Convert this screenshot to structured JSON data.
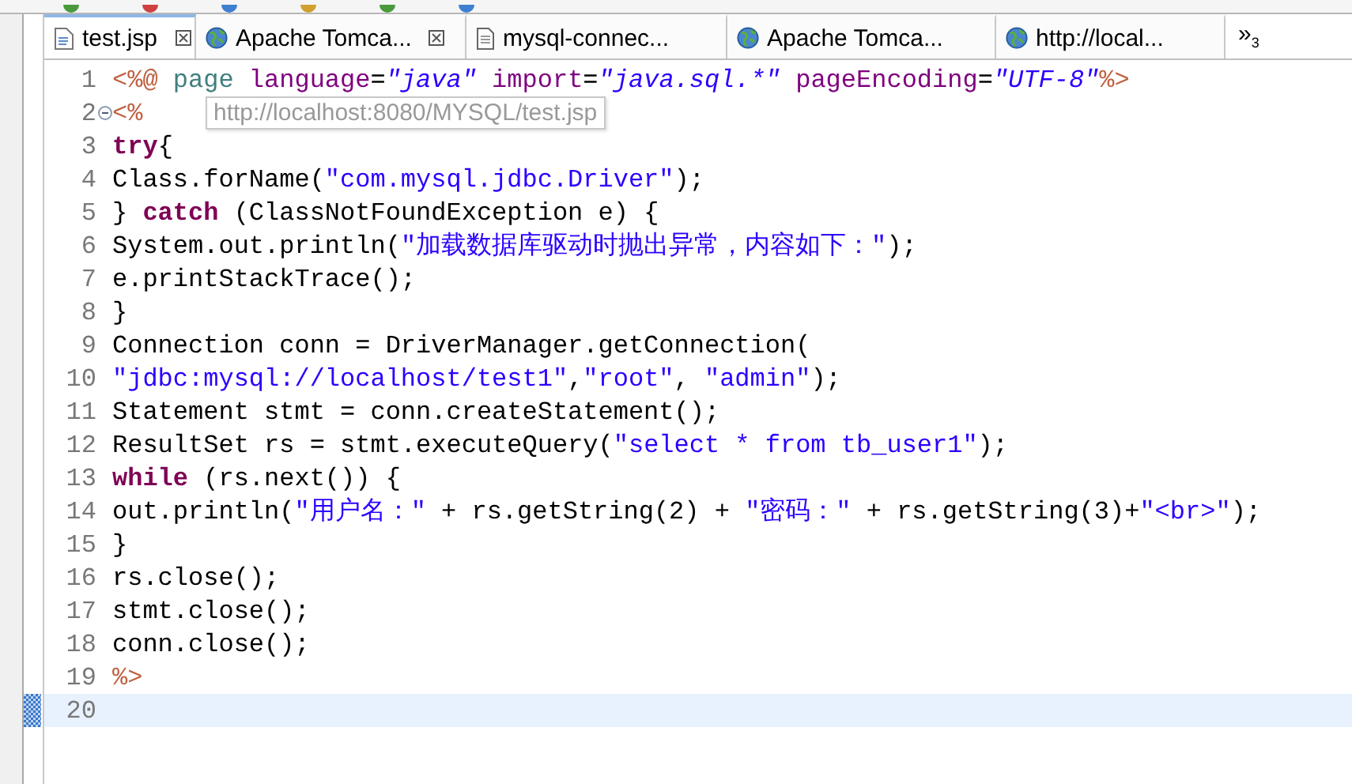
{
  "tabs": [
    {
      "label": "test.jsp",
      "kind": "jsp",
      "closable": true,
      "selected": true
    },
    {
      "label": "Apache Tomca...",
      "kind": "browser",
      "closable": true,
      "selected": false
    },
    {
      "label": "mysql-connec...",
      "kind": "text",
      "closable": false,
      "selected": false
    },
    {
      "label": "Apache Tomca...",
      "kind": "browser",
      "closable": false,
      "selected": false
    },
    {
      "label": "http://local...",
      "kind": "browser",
      "closable": false,
      "selected": false
    }
  ],
  "overflow": {
    "symbol": "»",
    "count": "3"
  },
  "tooltip": "http://localhost:8080/MYSQL/test.jsp",
  "lines": [
    {
      "number": "1",
      "fold": false,
      "current": false,
      "tokens": [
        {
          "kind": "tag",
          "text": "<%@"
        },
        {
          "kind": "tagname",
          "text": " page "
        },
        {
          "kind": "attr",
          "text": "language"
        },
        {
          "kind": "plain",
          "text": "="
        },
        {
          "kind": "value",
          "text": "\"java\""
        },
        {
          "kind": "attr",
          "text": " import"
        },
        {
          "kind": "plain",
          "text": "="
        },
        {
          "kind": "value",
          "text": "\"java.sql.*\""
        },
        {
          "kind": "attr",
          "text": " pageEncoding"
        },
        {
          "kind": "plain",
          "text": "="
        },
        {
          "kind": "value",
          "text": "\"UTF-8\""
        },
        {
          "kind": "tag",
          "text": "%>"
        }
      ]
    },
    {
      "number": "2",
      "fold": true,
      "current": false,
      "tokens": [
        {
          "kind": "tag",
          "text": "<%"
        }
      ]
    },
    {
      "number": "3",
      "fold": false,
      "current": false,
      "tokens": [
        {
          "kind": "keyword",
          "text": "try"
        },
        {
          "kind": "plain",
          "text": "{"
        }
      ]
    },
    {
      "number": "4",
      "fold": false,
      "current": false,
      "tokens": [
        {
          "kind": "plain",
          "text": "Class.forName("
        },
        {
          "kind": "string",
          "text": "\"com.mysql.jdbc.Driver\""
        },
        {
          "kind": "plain",
          "text": ");"
        }
      ]
    },
    {
      "number": "5",
      "fold": false,
      "current": false,
      "tokens": [
        {
          "kind": "plain",
          "text": "} "
        },
        {
          "kind": "keyword",
          "text": "catch"
        },
        {
          "kind": "plain",
          "text": " (ClassNotFoundException e) {"
        }
      ]
    },
    {
      "number": "6",
      "fold": false,
      "current": false,
      "tokens": [
        {
          "kind": "plain",
          "text": "System.out.println("
        },
        {
          "kind": "string",
          "text": "\"加载数据库驱动时抛出异常，内容如下：\""
        },
        {
          "kind": "plain",
          "text": ");"
        }
      ]
    },
    {
      "number": "7",
      "fold": false,
      "current": false,
      "tokens": [
        {
          "kind": "plain",
          "text": "e.printStackTrace();"
        }
      ]
    },
    {
      "number": "8",
      "fold": false,
      "current": false,
      "tokens": [
        {
          "kind": "plain",
          "text": "}"
        }
      ]
    },
    {
      "number": "9",
      "fold": false,
      "current": false,
      "tokens": [
        {
          "kind": "plain",
          "text": "Connection conn = DriverManager.getConnection("
        }
      ]
    },
    {
      "number": "10",
      "fold": false,
      "current": false,
      "tokens": [
        {
          "kind": "string",
          "text": "\"jdbc:mysql://localhost/test1\""
        },
        {
          "kind": "plain",
          "text": ","
        },
        {
          "kind": "string",
          "text": "\"root\""
        },
        {
          "kind": "plain",
          "text": ", "
        },
        {
          "kind": "string",
          "text": "\"admin\""
        },
        {
          "kind": "plain",
          "text": ");"
        }
      ]
    },
    {
      "number": "11",
      "fold": false,
      "current": false,
      "tokens": [
        {
          "kind": "plain",
          "text": "Statement stmt = conn.createStatement();"
        }
      ]
    },
    {
      "number": "12",
      "fold": false,
      "current": false,
      "tokens": [
        {
          "kind": "plain",
          "text": "ResultSet rs = stmt.executeQuery("
        },
        {
          "kind": "string",
          "text": "\"select * from tb_user1\""
        },
        {
          "kind": "plain",
          "text": ");"
        }
      ]
    },
    {
      "number": "13",
      "fold": false,
      "current": false,
      "tokens": [
        {
          "kind": "keyword",
          "text": "while"
        },
        {
          "kind": "plain",
          "text": " (rs.next()) {"
        }
      ]
    },
    {
      "number": "14",
      "fold": false,
      "current": false,
      "tokens": [
        {
          "kind": "plain",
          "text": "out.println("
        },
        {
          "kind": "string",
          "text": "\"用户名：\""
        },
        {
          "kind": "plain",
          "text": " + rs.getString(2) + "
        },
        {
          "kind": "string",
          "text": "\"密码：\""
        },
        {
          "kind": "plain",
          "text": " + rs.getString(3)+"
        },
        {
          "kind": "string",
          "text": "\"<br>\""
        },
        {
          "kind": "plain",
          "text": ");"
        }
      ]
    },
    {
      "number": "15",
      "fold": false,
      "current": false,
      "tokens": [
        {
          "kind": "plain",
          "text": "}"
        }
      ]
    },
    {
      "number": "16",
      "fold": false,
      "current": false,
      "tokens": [
        {
          "kind": "plain",
          "text": "rs.close();"
        }
      ]
    },
    {
      "number": "17",
      "fold": false,
      "current": false,
      "tokens": [
        {
          "kind": "plain",
          "text": "stmt.close();"
        }
      ]
    },
    {
      "number": "18",
      "fold": false,
      "current": false,
      "tokens": [
        {
          "kind": "plain",
          "text": "conn.close();"
        }
      ]
    },
    {
      "number": "19",
      "fold": false,
      "current": false,
      "tokens": [
        {
          "kind": "tag",
          "text": "%>"
        }
      ]
    },
    {
      "number": "20",
      "fold": false,
      "current": true
    }
  ]
}
